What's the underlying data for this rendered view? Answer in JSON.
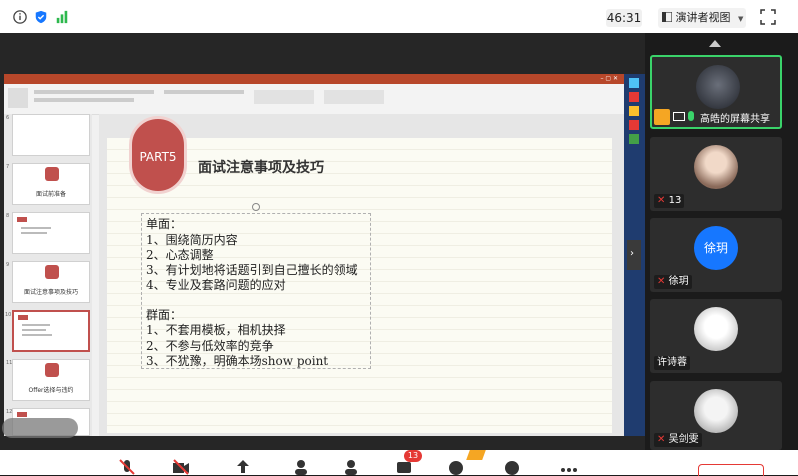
{
  "top_bar": {
    "timer": "46:31",
    "view_button": "演讲者视图",
    "view_caret": "▼"
  },
  "slide": {
    "part_label": "PART5",
    "title": "面试注意事项及技巧",
    "lines": [
      "单面：",
      "1、围绕简历内容",
      "2、心态调整",
      "3、有计划地将话题引到自己擅长的领域",
      "4、专业及套路问题的应对",
      "",
      "群面：",
      "1、不套用模板，相机抉择",
      "2、不参与低效率的竞争",
      "3、不犹豫，明确本场show point"
    ]
  },
  "thumbnails": [
    {
      "num": "6",
      "label": ""
    },
    {
      "num": "7",
      "label": "面试前准备"
    },
    {
      "num": "8",
      "label": ""
    },
    {
      "num": "9",
      "label": "面试注意事项及技巧"
    },
    {
      "num": "10",
      "label": ""
    },
    {
      "num": "11",
      "label": "Offer选择与违约"
    },
    {
      "num": "12",
      "label": ""
    }
  ],
  "participants": [
    {
      "name": "高皓的屏幕共享",
      "icon": "screen-share"
    },
    {
      "name": "13",
      "icon": "muted-mic"
    },
    {
      "name": "徐玥",
      "avatar_text": "徐玥",
      "icon": "muted-mic"
    },
    {
      "name": "许诗蓉",
      "icon": "muted-mic"
    },
    {
      "name": "吴剑雯",
      "icon": "muted-mic"
    }
  ],
  "bottom_bar": {
    "chat_badge": "13"
  },
  "colors": {
    "accent_green": "#3ad36a",
    "ppt_red": "#b7472a",
    "badge_red": "#c0504d",
    "avatar_blue": "#1677ff"
  }
}
